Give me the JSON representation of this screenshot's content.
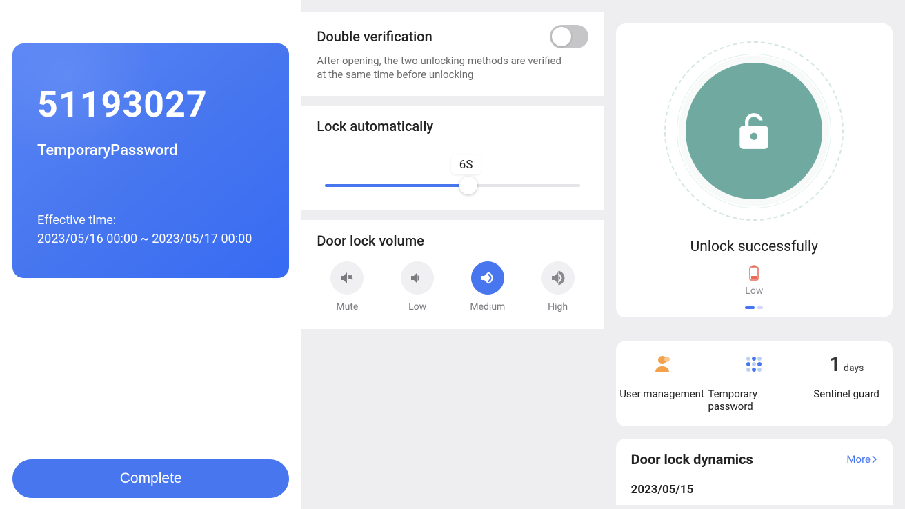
{
  "col1": {
    "password_number": "51193027",
    "password_label": "TemporaryPassword",
    "effective_label": "Effective time:",
    "effective_range": "2023/05/16 00:00 ~ 2023/05/17 00:00",
    "complete_button": "Complete"
  },
  "col2": {
    "dv_title": "Double verification",
    "dv_sub": "After opening, the two unlocking methods are verified at the same time before unlocking",
    "la_title": "Lock automatically",
    "la_value": "6S",
    "vol_title": "Door lock volume",
    "vol": {
      "mute": "Mute",
      "low": "Low",
      "medium": "Medium",
      "high": "High"
    }
  },
  "col3": {
    "status_text": "Unlock successfully",
    "battery_label": "Low",
    "grid": {
      "user_mgmt": "User management",
      "temp_pw": "Temporary password",
      "sentinel": "Sentinel guard",
      "sentinel_days_num": "1",
      "sentinel_days_unit": "days"
    },
    "dynamics": {
      "title": "Door lock dynamics",
      "more": "More",
      "date": "2023/05/15"
    }
  }
}
